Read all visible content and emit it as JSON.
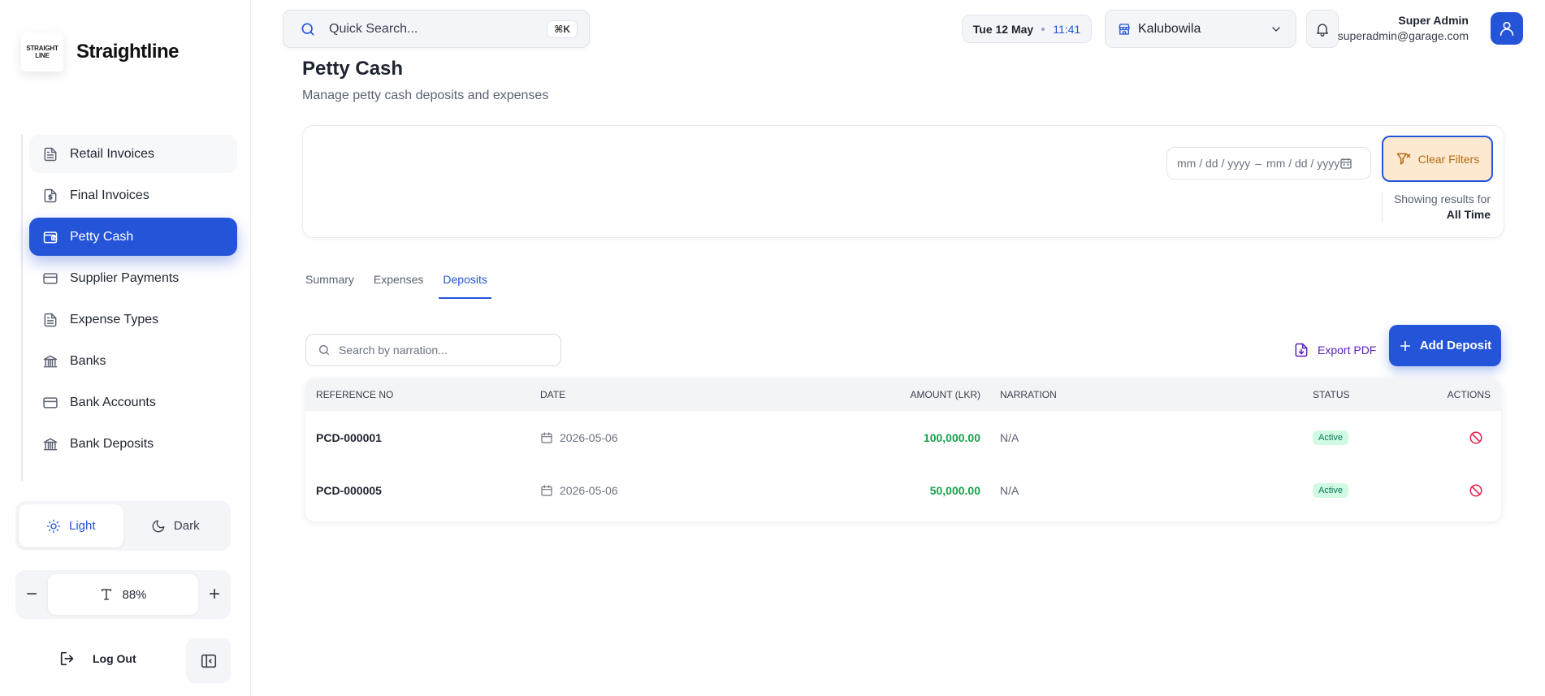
{
  "brand": {
    "logo_line1": "STRAIGHT",
    "logo_line2": "LINE",
    "name": "Straightline"
  },
  "sidebar": {
    "items": [
      {
        "label": "Retail Invoices",
        "icon": "file-text-icon"
      },
      {
        "label": "Final Invoices",
        "icon": "file-dollar-icon"
      },
      {
        "label": "Petty Cash",
        "icon": "wallet-icon",
        "active": true
      },
      {
        "label": "Supplier Payments",
        "icon": "credit-card-icon"
      },
      {
        "label": "Expense Types",
        "icon": "file-text-icon"
      },
      {
        "label": "Banks",
        "icon": "bank-icon"
      },
      {
        "label": "Bank Accounts",
        "icon": "credit-card-icon"
      },
      {
        "label": "Bank Deposits",
        "icon": "bank-icon"
      }
    ],
    "theme": {
      "light": "Light",
      "dark": "Dark",
      "selected": "Light"
    },
    "font_scale": {
      "value": "88%",
      "minus": "−",
      "plus": "+"
    },
    "logout": "Log Out"
  },
  "header": {
    "search_placeholder": "Quick Search...",
    "shortcut": "⌘K",
    "date": "Tue 12 May",
    "time": "11:41",
    "branch": "Kalubowila",
    "user": {
      "name": "Super Admin",
      "email": "superadmin@garage.com"
    }
  },
  "page": {
    "title": "Petty Cash",
    "subtitle": "Manage petty cash deposits and expenses"
  },
  "filters": {
    "date_from_placeholder": "mm / dd / yyyy",
    "date_sep": "–",
    "date_to_placeholder": "mm / dd / yyyy",
    "clear_label": "Clear Filters",
    "showing_label": "Showing results for",
    "showing_value": "All Time"
  },
  "tabs": [
    {
      "label": "Summary"
    },
    {
      "label": "Expenses"
    },
    {
      "label": "Deposits",
      "active": true
    }
  ],
  "table_tools": {
    "search_placeholder": "Search by narration...",
    "export_label": "Export PDF",
    "add_label": "Add Deposit"
  },
  "table": {
    "columns": [
      "Reference No",
      "Date",
      "Amount (LKR)",
      "Narration",
      "Status",
      "Actions"
    ],
    "rows": [
      {
        "ref": "PCD-000001",
        "date": "2026-05-06",
        "amount": "100,000.00",
        "narration": "N/A",
        "status": "Active"
      },
      {
        "ref": "PCD-000005",
        "date": "2026-05-06",
        "amount": "50,000.00",
        "narration": "N/A",
        "status": "Active"
      }
    ]
  },
  "colors": {
    "primary": "#2454d8",
    "amount_green": "#16a34a",
    "status_bg": "#d1fae5",
    "danger": "#e11d48",
    "clear_bg": "#fde9d0"
  }
}
